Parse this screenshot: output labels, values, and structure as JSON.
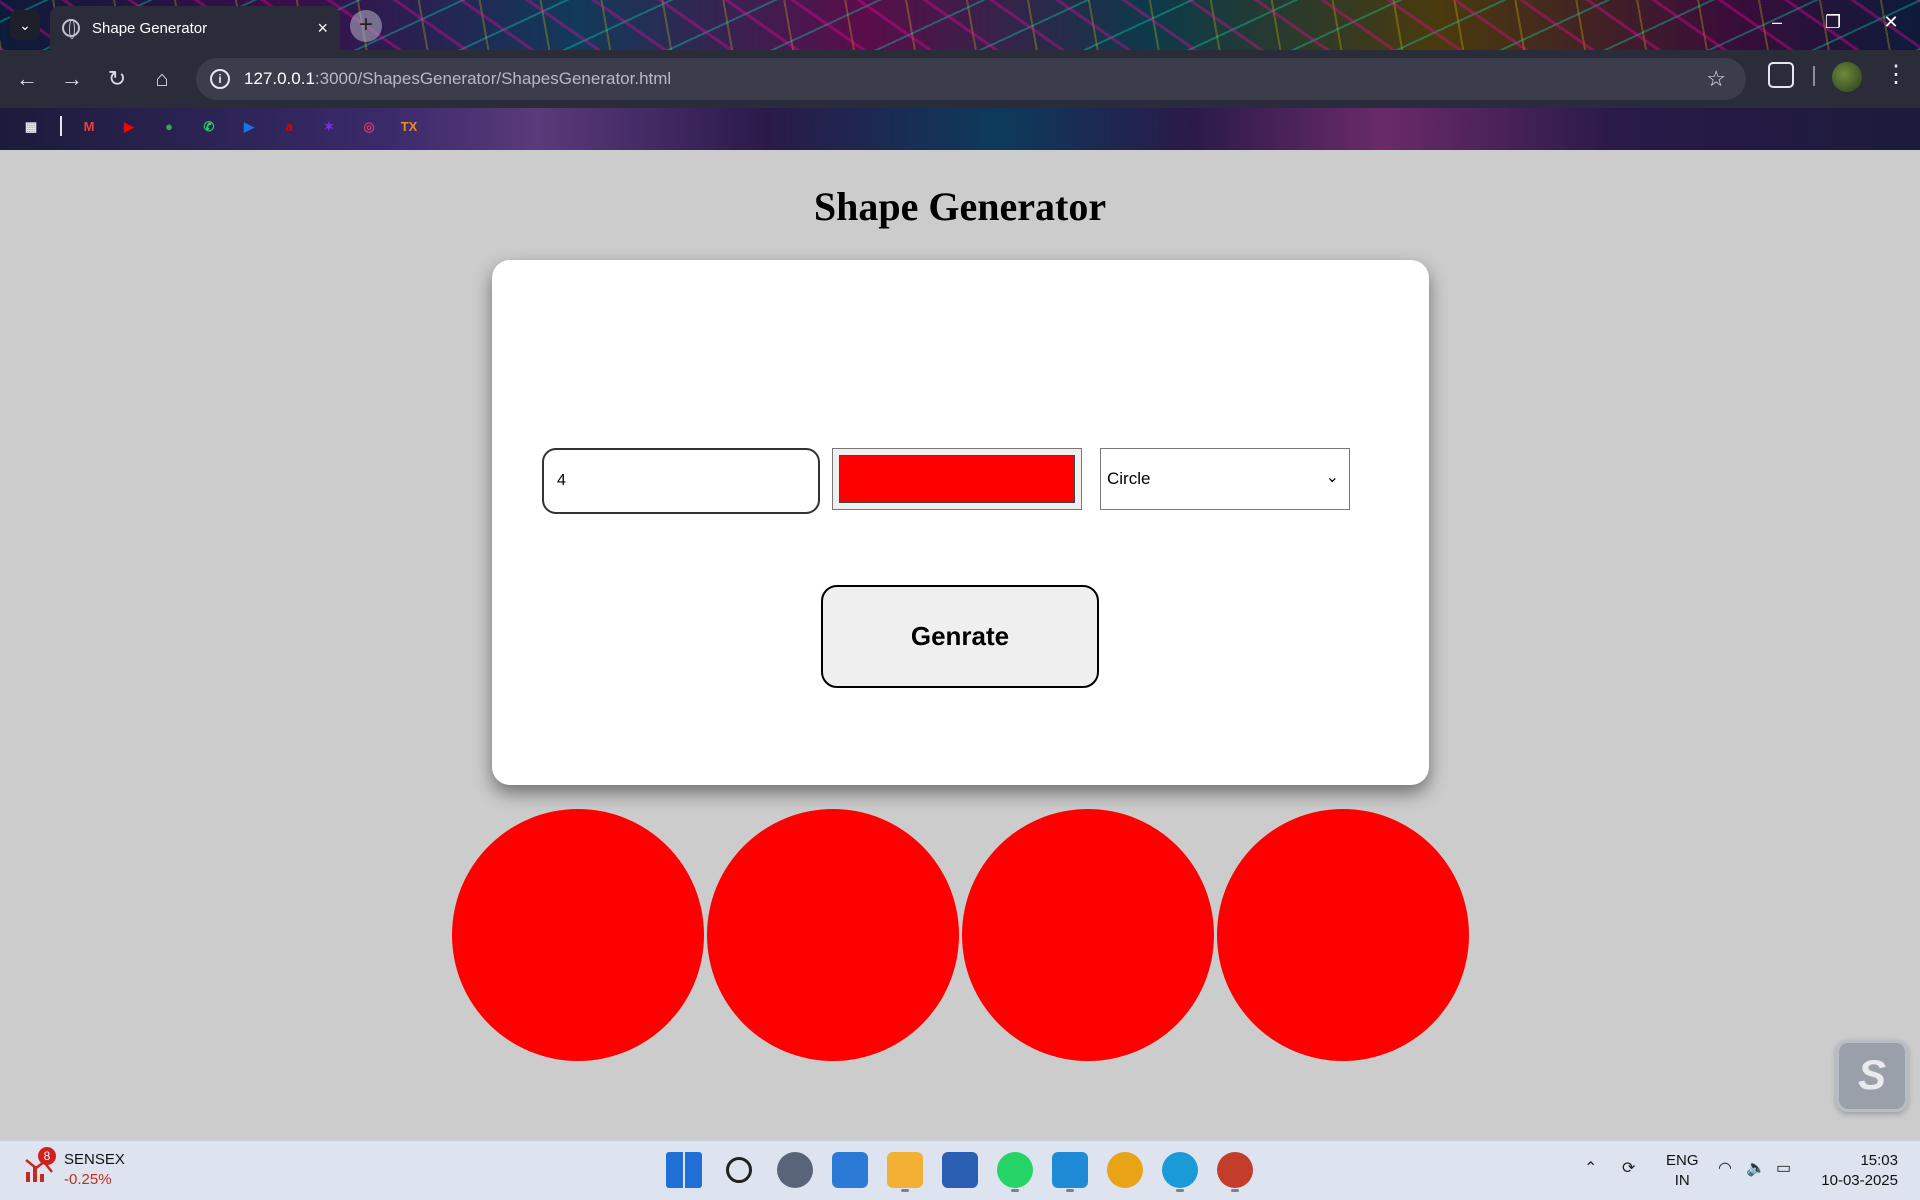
{
  "browser": {
    "tab_title": "Shape Generator",
    "tab_close": "×",
    "new_tab": "+",
    "url_host": "127.0.0.1",
    "url_path": ":3000/ShapesGenerator/ShapesGenerator.html",
    "window_controls": {
      "minimize": "–",
      "restore": "❐",
      "close": "✕"
    }
  },
  "bookmarks": [
    {
      "icon": "apps-grid-icon",
      "glyph": "▦",
      "color": "#e6e7ee"
    },
    {
      "icon": "gmail-icon",
      "glyph": "M",
      "color": "#ea4335"
    },
    {
      "icon": "youtube-icon",
      "glyph": "▶",
      "color": "#ff0000"
    },
    {
      "icon": "maps-icon",
      "glyph": "●",
      "color": "#34a853"
    },
    {
      "icon": "whatsapp-icon",
      "glyph": "✆",
      "color": "#25d366"
    },
    {
      "icon": "play-icon",
      "glyph": "▶",
      "color": "#1a73e8"
    },
    {
      "icon": "airtel-icon",
      "glyph": "a",
      "color": "#e40000"
    },
    {
      "icon": "canva-icon",
      "glyph": "✶",
      "color": "#7d2ae8"
    },
    {
      "icon": "instagram-icon",
      "glyph": "◎",
      "color": "#e1306c"
    },
    {
      "icon": "tx-icon",
      "glyph": "TX",
      "color": "#f08a24"
    }
  ],
  "page": {
    "title": "Shape Generator",
    "count_value": "4",
    "color_value": "#ff0000",
    "shape_options": [
      "Circle"
    ],
    "shape_selected": "Circle",
    "button_label": "Genrate"
  },
  "generated_shapes": {
    "count": 4,
    "shape": "circle",
    "color": "#ff0000"
  },
  "taskbar": {
    "stock_name": "SENSEX",
    "stock_change": "-0.25%",
    "stock_badge": "8",
    "apps": [
      {
        "name": "windows-start-icon",
        "color": "#1f6fd6"
      },
      {
        "name": "search-icon",
        "color": "#222222"
      },
      {
        "name": "settings-icon",
        "color": "#5a6478"
      },
      {
        "name": "photos-icon",
        "color": "#2a7ad6"
      },
      {
        "name": "file-explorer-icon",
        "color": "#f2b134"
      },
      {
        "name": "store-icon",
        "color": "#2b5fb3"
      },
      {
        "name": "whatsapp-icon",
        "color": "#25d366"
      },
      {
        "name": "vscode-icon",
        "color": "#1f8ad6"
      },
      {
        "name": "chrome-icon",
        "color": "#e8a317"
      },
      {
        "name": "edge-icon",
        "color": "#1a9ad6"
      },
      {
        "name": "chrome-profile-icon",
        "color": "#c43d2b"
      }
    ],
    "lang_top": "ENG",
    "lang_bottom": "IN",
    "time": "15:03",
    "date": "10-03-2025"
  }
}
